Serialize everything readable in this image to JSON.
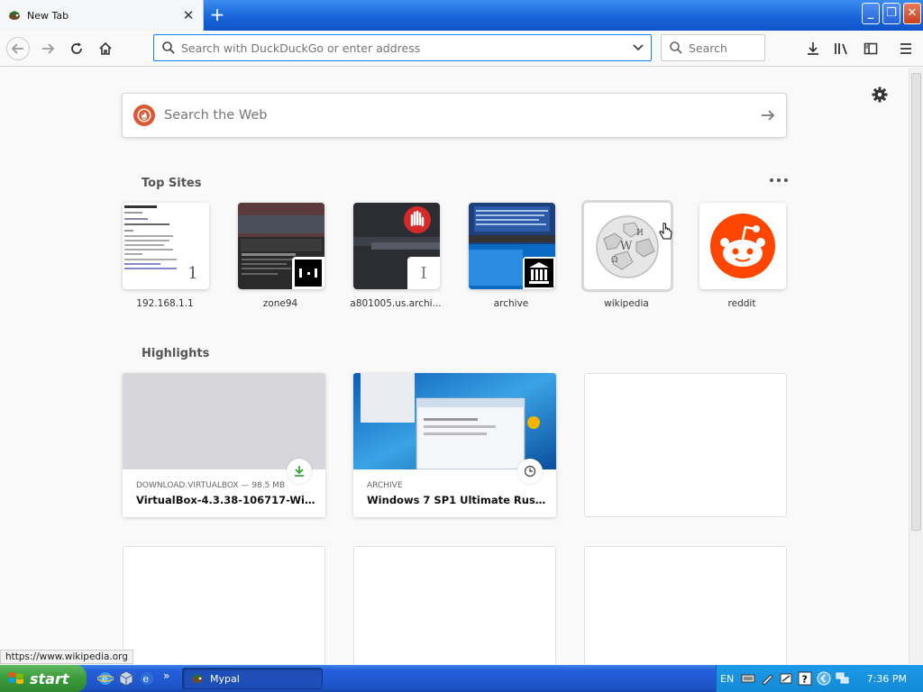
{
  "window": {
    "tab_title": "New Tab",
    "tab_close": "✕",
    "new_tab": "+",
    "controls": {
      "minimize": "_",
      "maximize": "❐",
      "close": "✕"
    }
  },
  "toolbar": {
    "url_placeholder": "Search with DuckDuckGo or enter address",
    "search_placeholder": "Search",
    "icons": [
      "back-icon",
      "forward-icon",
      "reload-icon",
      "home-icon",
      "download-icon",
      "library-icon",
      "sidebar-icon",
      "menu-icon"
    ]
  },
  "newtab": {
    "web_search_placeholder": "Search the Web",
    "top_sites_title": "Top Sites",
    "highlights_title": "Highlights",
    "top_sites": [
      {
        "label": "192.168.1.1",
        "badge": "1"
      },
      {
        "label": "zone94",
        "badge": ""
      },
      {
        "label": "a801005.us.archi...",
        "badge": "I"
      },
      {
        "label": "archive",
        "badge": ""
      },
      {
        "label": "wikipedia",
        "badge": ""
      },
      {
        "label": "reddit",
        "badge": ""
      }
    ],
    "highlights": [
      {
        "source": "DOWNLOAD.VIRTUALBOX — 98.5 MB",
        "title": "VirtualBox-4.3.38-106717-Win...."
      },
      {
        "source": "ARCHIVE",
        "title": "Windows 7 SP1 Ultimate Russian..."
      }
    ]
  },
  "status_url": "https://www.wikipedia.org",
  "taskbar": {
    "start": "start",
    "task_label": "Mypal",
    "chevron": "»",
    "lang": "EN",
    "time": "7:36 PM"
  },
  "colors": {
    "accent": "#0a84ff",
    "ddg": "#de5833",
    "reddit": "#ff4500",
    "xp_blue": "#245edb",
    "xp_green": "#3a9a3a"
  }
}
